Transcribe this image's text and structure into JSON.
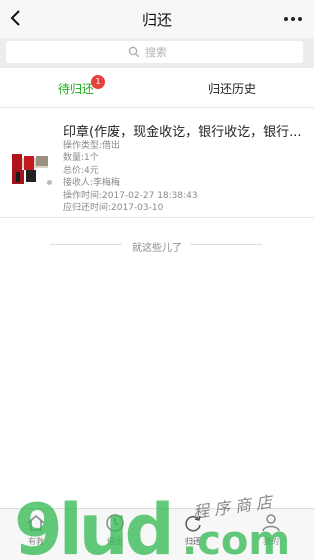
{
  "header": {
    "title": "归还"
  },
  "search": {
    "placeholder": "搜索"
  },
  "tabs": [
    {
      "label": "待归还",
      "badge": "1"
    },
    {
      "label": "归还历史"
    }
  ],
  "items": [
    {
      "title": "印章(作废，现金收讫，银行收讫，银行...",
      "details": [
        "操作类型:借出",
        "数量:1个",
        "总价:4元",
        "接收人:李梅梅",
        "操作时间:2017-02-27 18:38:43",
        "应归还时间:2017-03-10"
      ]
    }
  ],
  "end_note": "就这些儿了",
  "tabbar": [
    {
      "label": "有救",
      "icon": "home-icon"
    },
    {
      "label": "借出",
      "icon": "clock-icon"
    },
    {
      "label": "归还",
      "icon": "refresh-icon"
    },
    {
      "label": "我的",
      "icon": "person-icon"
    }
  ],
  "watermark": {
    "text": "9lud.com",
    "subtext": "程序商店"
  },
  "colors": {
    "accent": "#1aad19",
    "badge": "#e64340",
    "watermark": "#2db84d"
  }
}
